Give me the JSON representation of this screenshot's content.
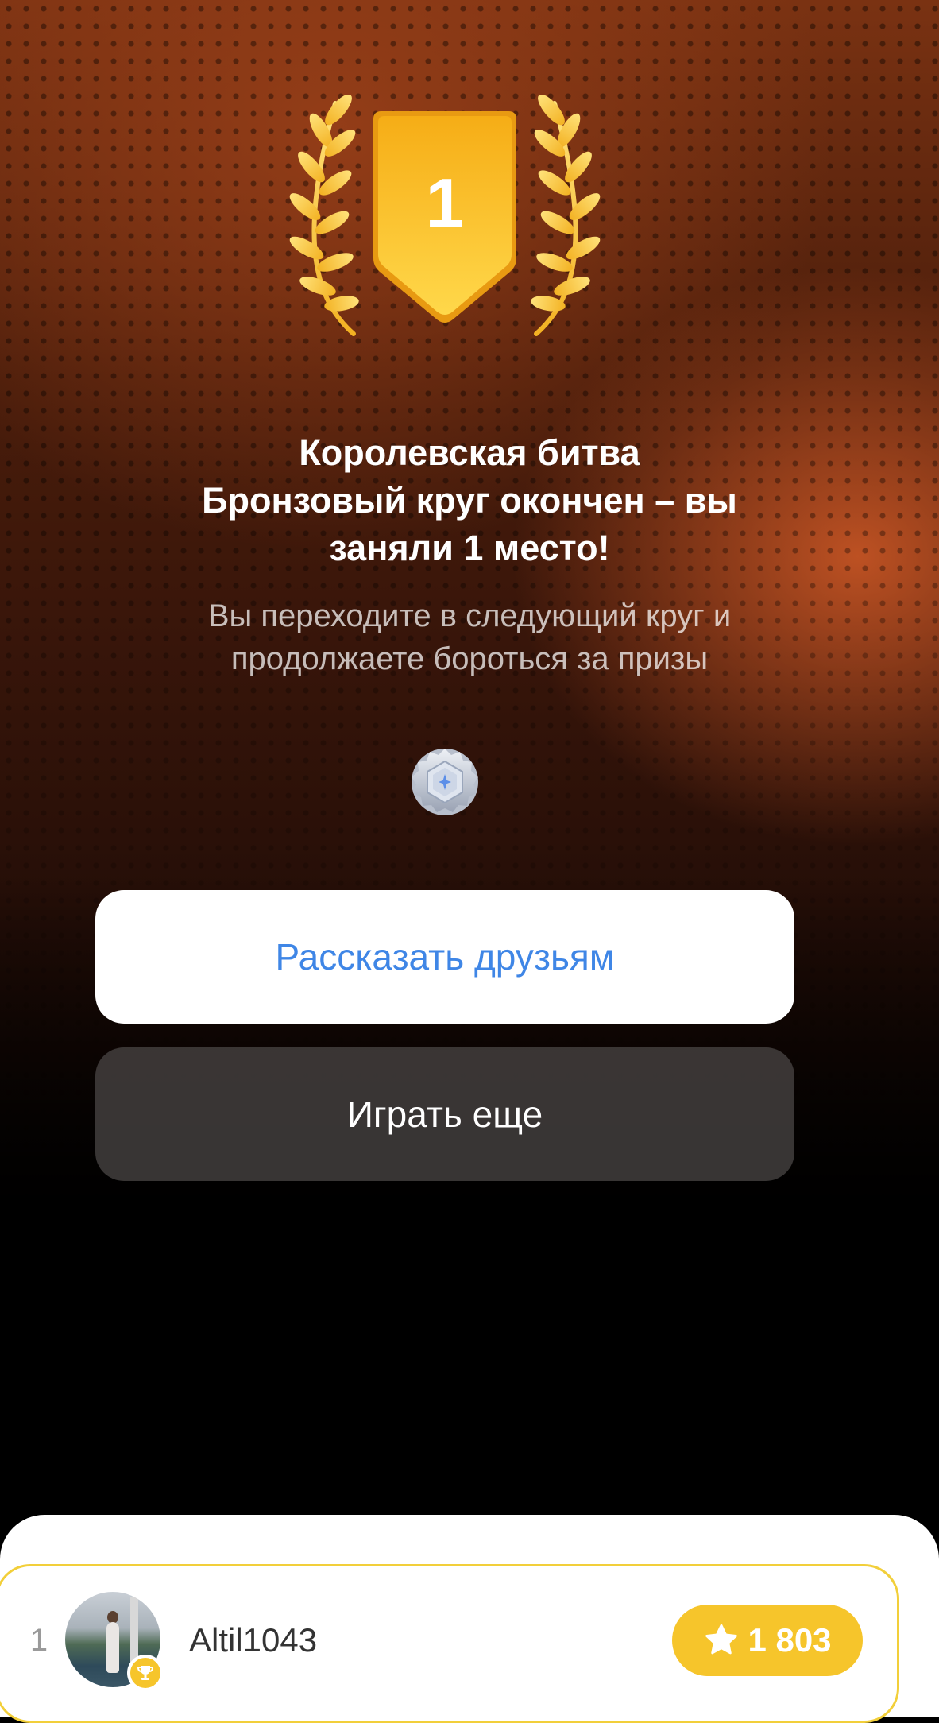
{
  "result": {
    "place": "1",
    "title_lines": [
      "Королевская битва",
      "Бронзовый круг окончен – вы",
      "заняли 1 место!"
    ],
    "subtitle_lines": [
      "Вы переходите в следующий круг и",
      "продолжаете бороться за призы"
    ]
  },
  "actions": {
    "share_label": "Рассказать друзьям",
    "play_again_label": "Играть еще"
  },
  "leaderboard": {
    "entries": [
      {
        "rank": "1",
        "username": "Altil1043",
        "score": "1 803"
      }
    ]
  },
  "icons": {
    "medal": "laurel-shield-medal-icon",
    "league": "silver-league-badge-icon",
    "trophy": "trophy-icon",
    "score": "star-icon"
  },
  "colors": {
    "gold": "#f6c52b",
    "accent_blue": "#3f86e6",
    "background": "#000000"
  }
}
